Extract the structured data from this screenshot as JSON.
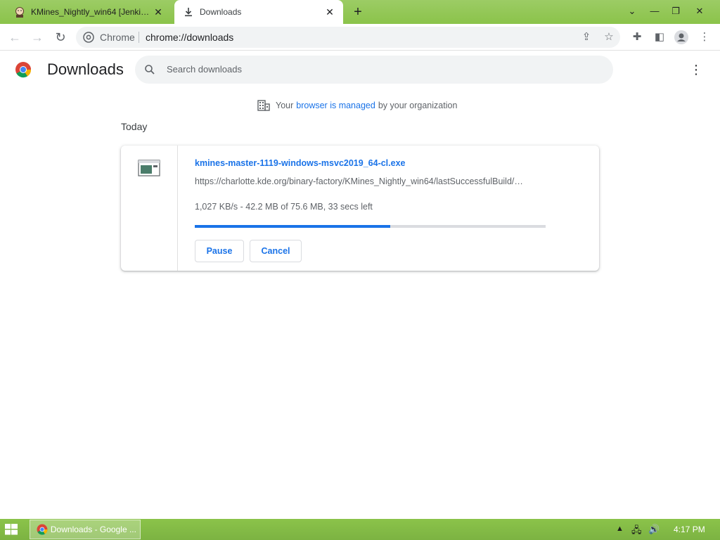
{
  "tabs": [
    {
      "title": "KMines_Nightly_win64 [Jenkins]",
      "active": false,
      "favicon": "jenkins-icon"
    },
    {
      "title": "Downloads",
      "active": true,
      "favicon": "download-icon"
    }
  ],
  "toolbar": {
    "site_chip": "Chrome",
    "url": "chrome://downloads"
  },
  "page": {
    "title": "Downloads",
    "search_placeholder": "Search downloads",
    "managed_before": "Your",
    "managed_link": "browser is managed",
    "managed_after": "by your organization",
    "date_header": "Today"
  },
  "download": {
    "file_name": "kmines-master-1119-windows-msvc2019_64-cl.exe",
    "url": "https://charlotte.kde.org/binary-factory/KMines_Nightly_win64/lastSuccessfulBuild/…",
    "status": "1,027 KB/s - 42.2 MB of 75.6 MB, 33 secs left",
    "progress_fraction": 0.558,
    "pause_label": "Pause",
    "cancel_label": "Cancel"
  },
  "taskbar": {
    "task_title": "Downloads - Google ...",
    "clock": "4:17 PM"
  },
  "colors": {
    "accent": "#1a73e8",
    "theme": "#8bc34a"
  }
}
